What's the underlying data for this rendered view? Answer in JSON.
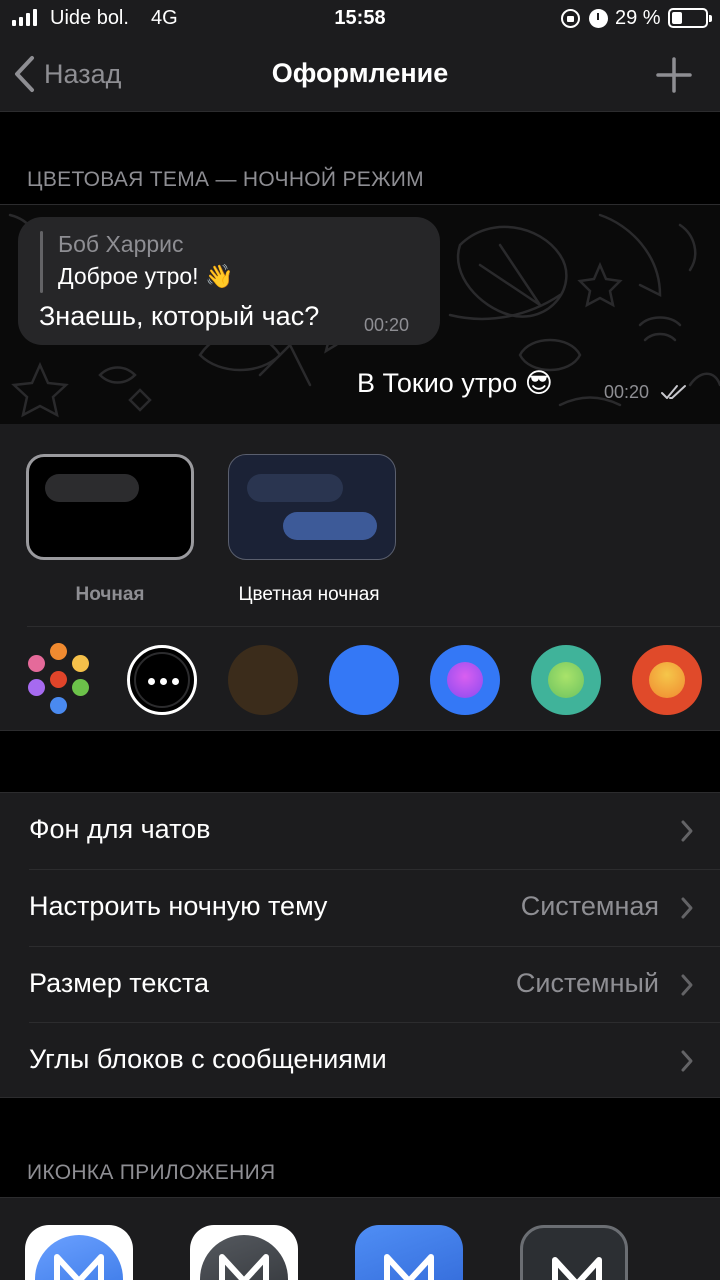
{
  "status_bar": {
    "carrier": "Uide bol.",
    "network": "4G",
    "time": "15:58",
    "battery_percent": "29 %"
  },
  "nav": {
    "back_label": "Назад",
    "title": "Оформление",
    "add_icon": "plus-icon"
  },
  "color_theme_section": {
    "header": "ЦВЕТОВАЯ ТЕМА — НОЧНОЙ РЕЖИМ"
  },
  "preview": {
    "reply_name": "Боб Харрис",
    "reply_text": "Доброе утро! 👋",
    "incoming_text": "Знаешь, который час?",
    "incoming_time": "00:20",
    "outgoing_text": "В Токио утро 😎",
    "outgoing_time": "00:20"
  },
  "themes": [
    {
      "label": "Ночная",
      "selected": true
    },
    {
      "label": "Цветная ночная",
      "selected": false
    }
  ],
  "accent_swatches": [
    "multicolor",
    "more",
    "#3b2c1b",
    "#3478f6",
    "#3478f6/#c85af0",
    "#40b39a/#8fd46a",
    "#e04a2a/#f5b840"
  ],
  "settings": {
    "chat_background": {
      "label": "Фон для чатов",
      "value": ""
    },
    "night_theme": {
      "label": "Настроить ночную тему",
      "value": "Системная"
    },
    "text_size": {
      "label": "Размер текста",
      "value": "Системный"
    },
    "bubble_corners": {
      "label": "Углы блоков с сообщениями",
      "value": ""
    }
  },
  "app_icon_section": {
    "header": "ИКОНКА ПРИЛОЖЕНИЯ"
  },
  "colors": {
    "background": "#000000",
    "card": "#1c1c1e",
    "secondary_text": "#8e8e93",
    "accent_blue": "#3478f6"
  }
}
